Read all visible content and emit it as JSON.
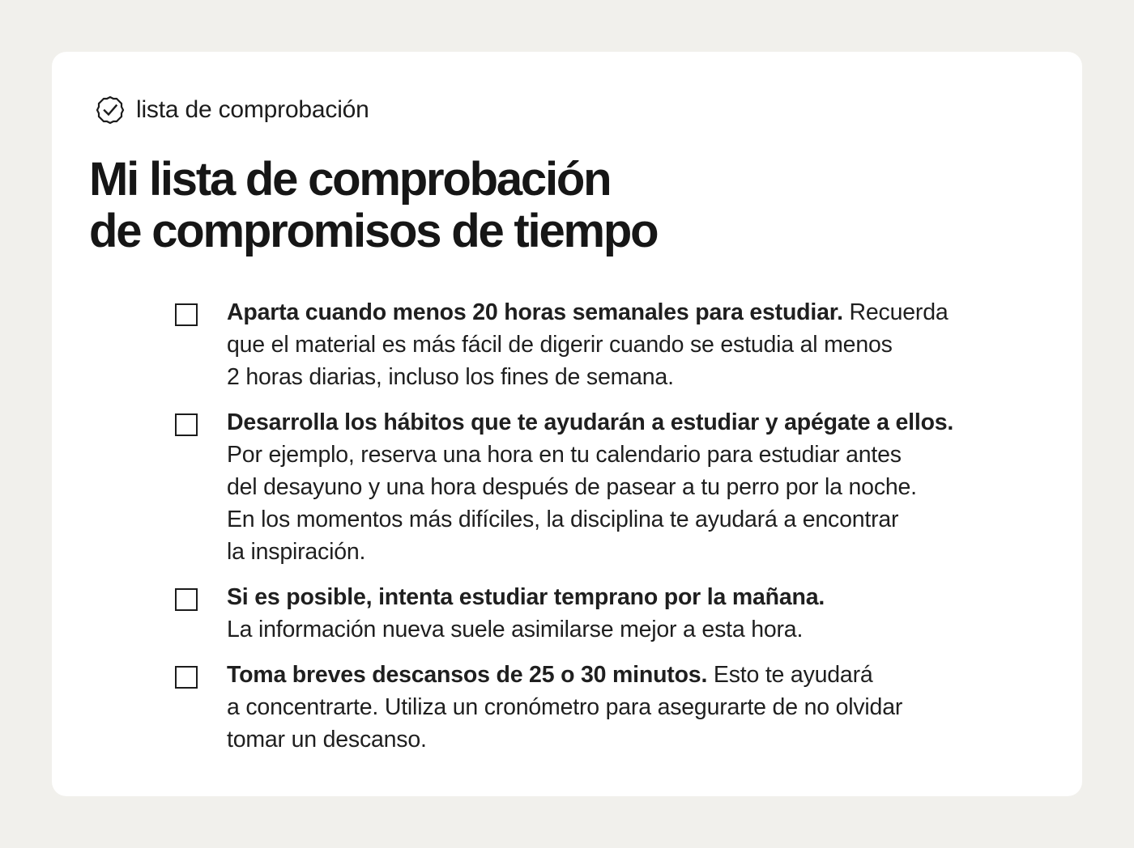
{
  "header": {
    "eyebrow_icon": "check-circle-icon",
    "eyebrow_label": "lista de comprobación",
    "title_line1": "Mi lista de comprobación",
    "title_line2": "de compromisos de tiempo"
  },
  "checklist": {
    "items": [
      {
        "checked": false,
        "bold": "Aparta cuando menos 20 horas semanales para estudiar.",
        "line1_rest": " Recuerda",
        "lines": [
          "que el material es más fácil de digerir cuando se estudia al menos",
          "2 horas diarias, incluso los fines de semana."
        ]
      },
      {
        "checked": false,
        "bold": "Desarrolla los hábitos que te ayudarán a estudiar y apégate a ellos.",
        "line1_rest": "",
        "lines": [
          "Por ejemplo, reserva una hora en tu calendario para estudiar antes",
          "del desayuno y una hora después de pasear a tu perro por la noche.",
          "En los momentos más difíciles, la disciplina te ayudará a encontrar",
          "la inspiración."
        ]
      },
      {
        "checked": false,
        "bold": "Si es posible, intenta estudiar temprano por la mañana.",
        "line1_rest": "",
        "lines": [
          "La información nueva suele asimilarse mejor a esta hora."
        ]
      },
      {
        "checked": false,
        "bold": "Toma breves descansos de 25 o 30 minutos.",
        "line1_rest": " Esto te ayudará",
        "lines": [
          "a concentrarte. Utiliza un cronómetro para asegurarte de no olvidar",
          "tomar un descanso."
        ]
      }
    ]
  }
}
